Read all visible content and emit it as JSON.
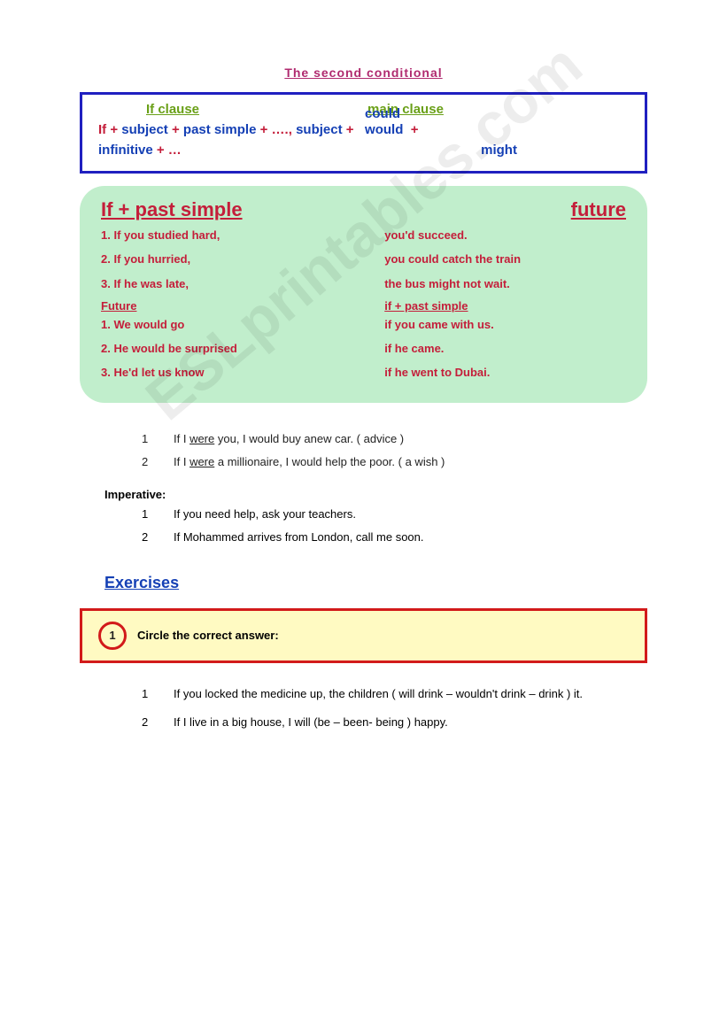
{
  "title": "The second conditional",
  "bluebox": {
    "header_if": "If clause",
    "header_main": "main clause",
    "if_word": "If",
    "plus": "+",
    "subject": "subject",
    "past_simple": "past simple",
    "dots": "….,",
    "modal_could": "could",
    "modal_would": "would",
    "modal_might": "might",
    "infinitive": "infinitive",
    "trail": "+ …"
  },
  "greenbox": {
    "hdr_left": "If + past simple",
    "hdr_right": "future",
    "rows1": [
      {
        "l": "1. If you studied hard,",
        "r": "you'd succeed."
      },
      {
        "l": "2. If you hurried,",
        "r": "you could catch the train"
      },
      {
        "l": "3. If he was late,",
        "r": "the bus might not wait."
      }
    ],
    "sub_left": "Future",
    "sub_right": "if + past simple",
    "rows2": [
      {
        "l": "1.  We would go",
        "r": "if you came with us."
      },
      {
        "l": "2.  He would be surprised",
        "r": "if he came."
      },
      {
        "l": "3. He'd let us know",
        "r": "if he went to Dubai."
      }
    ]
  },
  "notes": [
    {
      "n": "1",
      "pre": "If I ",
      "u": "were",
      "post": " you, I would buy anew car.  ( advice )"
    },
    {
      "n": "2",
      "pre": "If I ",
      "u": "were",
      "post": " a millionaire, I would help the poor. ( a wish )"
    }
  ],
  "imperative_label": "Imperative:",
  "imperative": [
    {
      "n": "1",
      "t": "If you need help, ask your teachers."
    },
    {
      "n": "2",
      "t": "If Mohammed arrives from London, call me soon."
    }
  ],
  "exercises_label": " Exercises",
  "exercise1": {
    "num": "1",
    "instr": "Circle the correct answer:",
    "items": [
      {
        "n": "1",
        "t": "If you locked the medicine up, the children ( will drink – wouldn't drink – drink ) it."
      },
      {
        "n": "2",
        "t": "If I live in a big house, I will (be – been- being ) happy."
      }
    ]
  },
  "watermark": "ESLprintables.com"
}
